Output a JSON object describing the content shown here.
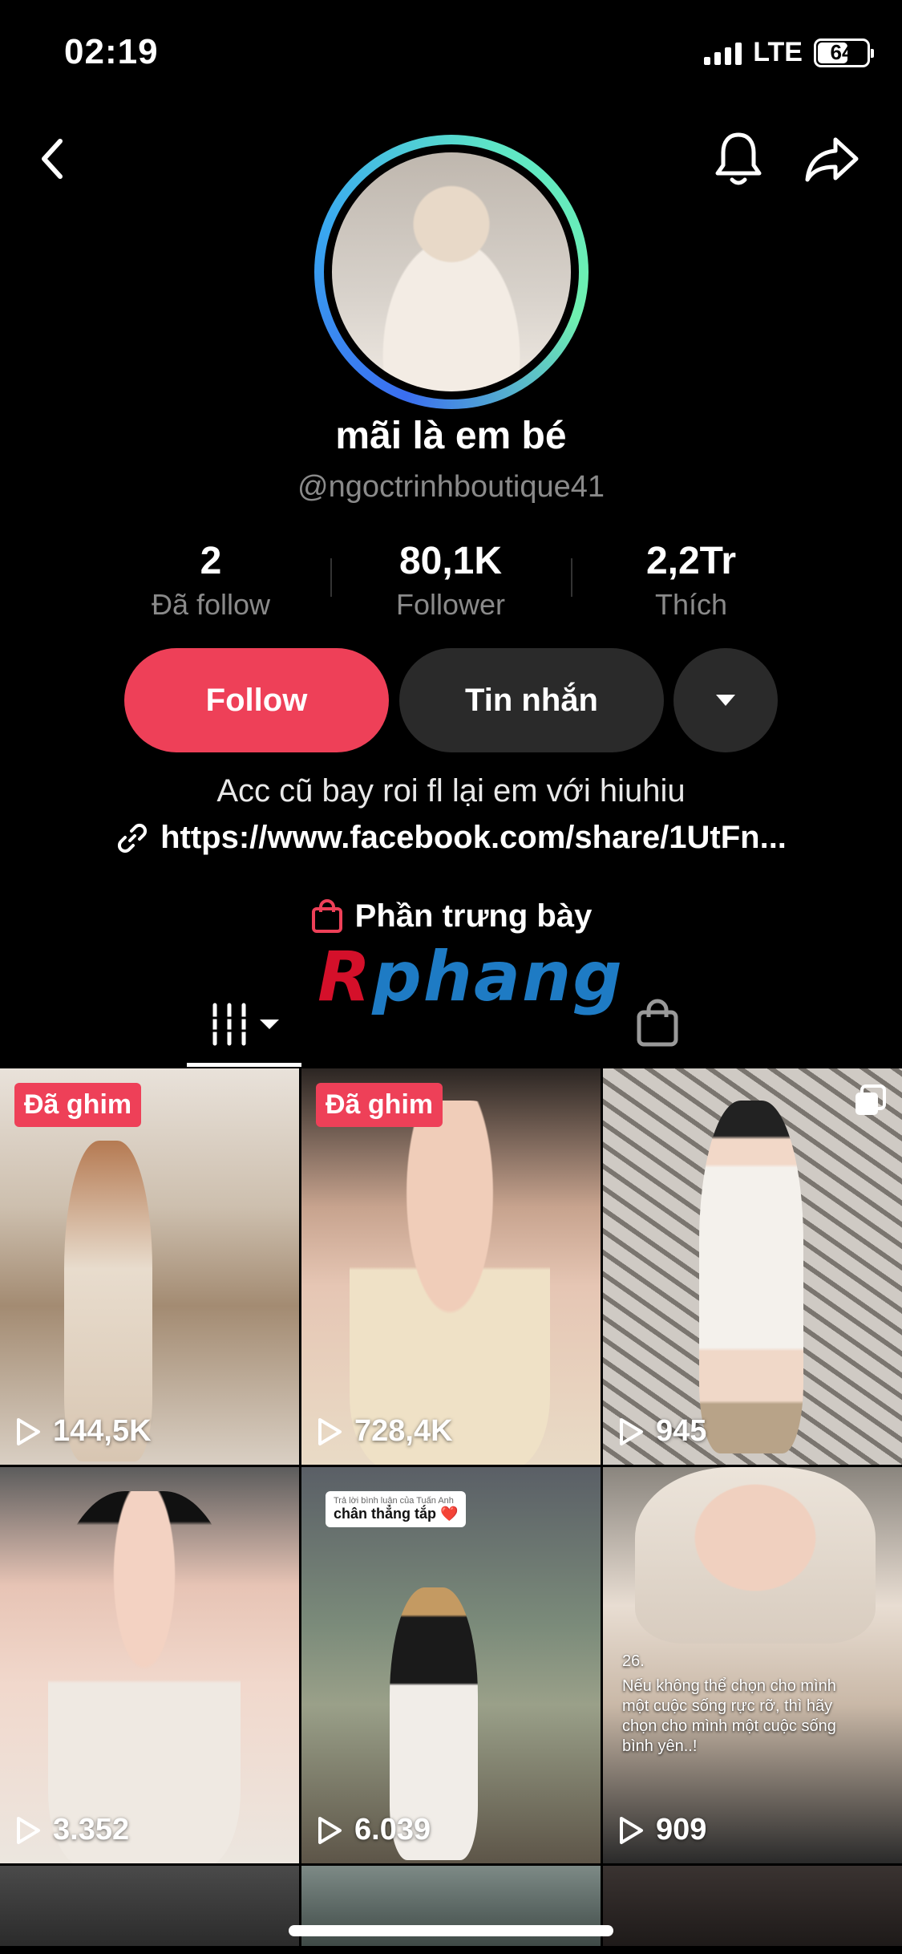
{
  "status_bar": {
    "time": "02:19",
    "network": "LTE",
    "battery": "64",
    "battery_level": 0.64
  },
  "nav": {
    "back_icon": "back-chevron-icon",
    "bell_icon": "bell-icon",
    "share_icon": "share-icon"
  },
  "profile": {
    "display_name": "mãi là em bé",
    "handle": "@ngoctrinhboutique41",
    "stats": [
      {
        "value": "2",
        "label": "Đã follow"
      },
      {
        "value": "80,1K",
        "label": "Follower"
      },
      {
        "value": "2,2Tr",
        "label": "Thích"
      }
    ],
    "follow_label": "Follow",
    "message_label": "Tin nhắn",
    "bio": "Acc cũ bay roi fl lại em với hiuhiu",
    "link": "https://www.facebook.com/share/1UtFn...",
    "showcase_label": "Phần trưng bày"
  },
  "watermark": {
    "r": "R",
    "rest": "phang"
  },
  "tabs": [
    {
      "icon": "videos-grid-icon"
    },
    {
      "icon": "shop-bag-icon"
    }
  ],
  "videos": [
    {
      "views": "144,5K",
      "pinned": "Đã ghim"
    },
    {
      "views": "728,4K",
      "pinned": "Đã ghim"
    },
    {
      "views": "945"
    },
    {
      "views": "3.352"
    },
    {
      "views": "6.039",
      "chip_small": "Trả lời bình luận của Tuấn Anh",
      "chip": "chân thẳng tắp ❤️"
    },
    {
      "views": "909",
      "overlay_num": "26.",
      "overlay": "Nếu không thể chọn cho mình một cuộc sống rực rỡ, thì hãy chọn cho mình một cuộc sống bình yên..!"
    }
  ]
}
